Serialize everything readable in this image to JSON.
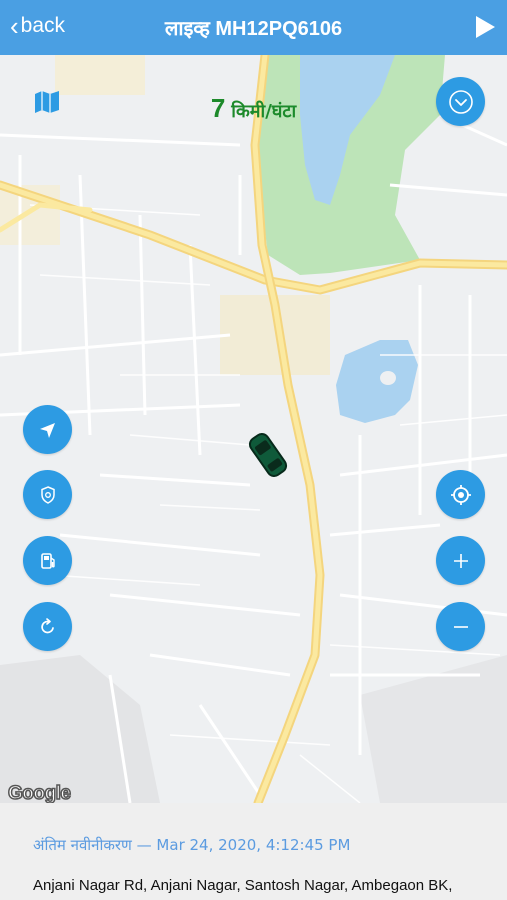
{
  "header": {
    "back_label": "back",
    "title": "लाइव्ह MH12PQ6106"
  },
  "map": {
    "speed_value": "7",
    "speed_unit": "किमी/घंटा",
    "attribution": "Google",
    "left_buttons": [
      "navigation-icon",
      "shield-icon",
      "fuel-icon",
      "refresh-icon"
    ],
    "right_buttons": [
      "dropdown-icon",
      "locate-icon",
      "zoom-in-icon",
      "zoom-out-icon"
    ]
  },
  "footer": {
    "last_updated": "अंतिम नवीनीकरण — Mar 24, 2020, 4:12:45 PM",
    "address": "Anjani Nagar Rd, Anjani Nagar, Santosh Nagar, Ambegaon BK,"
  },
  "colors": {
    "header_bg": "#4a9fe3",
    "fab_bg": "#2d9be3",
    "speed_text": "#1d8a2b",
    "updated_text": "#5b9be0"
  }
}
